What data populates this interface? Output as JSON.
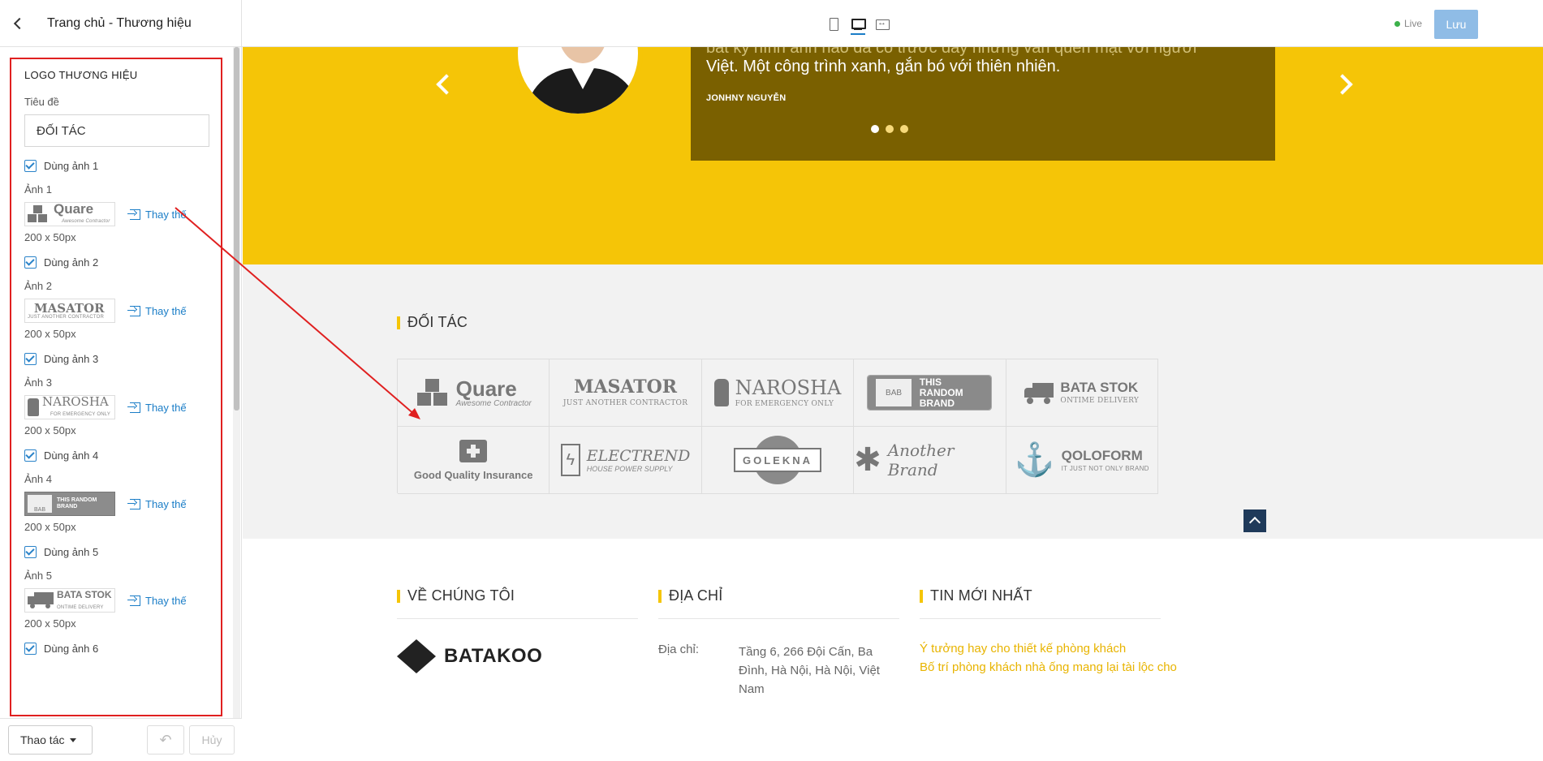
{
  "sidebar": {
    "title": "Trang chủ - Thương hiệu",
    "panel_title": "LOGO THƯƠNG HIỆU",
    "title_label": "Tiêu đề",
    "title_value": "ĐỐI TÁC",
    "items": [
      {
        "use_label": "Dùng ảnh 1",
        "img_label": "Ảnh 1",
        "thumb_main": "Quare",
        "thumb_sub": "Awesome Contractor",
        "replace": "Thay thế",
        "size": "200 x 50px"
      },
      {
        "use_label": "Dùng ảnh 2",
        "img_label": "Ảnh 2",
        "thumb_main": "MASATOR",
        "thumb_sub": "JUST ANOTHER CONTRACTOR",
        "replace": "Thay thế",
        "size": "200 x 50px"
      },
      {
        "use_label": "Dùng ảnh 3",
        "img_label": "Ảnh 3",
        "thumb_main": "NAROSHA",
        "thumb_sub": "FOR EMERGENCY ONLY",
        "replace": "Thay thế",
        "size": "200 x 50px"
      },
      {
        "use_label": "Dùng ảnh 4",
        "img_label": "Ảnh 4",
        "thumb_main": "THIS RANDOM BRAND",
        "thumb_sub": "BAB",
        "replace": "Thay thế",
        "size": "200 x 50px"
      },
      {
        "use_label": "Dùng ảnh 5",
        "img_label": "Ảnh 5",
        "thumb_main": "BATA STOK",
        "thumb_sub": "ONTIME DELIVERY",
        "replace": "Thay thế",
        "size": "200 x 50px"
      }
    ],
    "next_use_label": "Dùng ảnh 6",
    "actions_label": "Thao tác",
    "undo_icon": "↶",
    "cancel_label": "Hủy"
  },
  "topbar": {
    "live_label": "Live",
    "save_label": "Lưu"
  },
  "testimonial": {
    "line1": "bất kỳ hình ảnh nào đã có trước đây nhưng vẫn quen mặt với người",
    "line2": "Việt. Một công trình xanh, gắn bó với thiên nhiên.",
    "author": "JONHNY NGUYỄN"
  },
  "partners": {
    "title": "ĐỐI TÁC",
    "logos": [
      {
        "main": "Quare",
        "sub": "Awesome Contractor"
      },
      {
        "main": "MASATOR",
        "sub": "JUST ANOTHER CONTRACTOR"
      },
      {
        "main": "NAROSHA",
        "sub": "FOR EMERGENCY ONLY"
      },
      {
        "main": "THIS RANDOM BRAND",
        "sub": "BAB"
      },
      {
        "main": "BATA STOK",
        "sub": "ONTIME DELIVERY"
      },
      {
        "main": "Good Quality Insurance",
        "sub": ""
      },
      {
        "main": "ELECTREND",
        "sub": "HOUSE POWER SUPPLY"
      },
      {
        "main": "GOLEKNA",
        "sub": ""
      },
      {
        "main": "Another Brand",
        "sub": ""
      },
      {
        "main": "QOLOFORM",
        "sub": "IT JUST NOT ONLY BRAND"
      }
    ]
  },
  "footer": {
    "about_title": "VỀ CHÚNG TÔI",
    "address_title": "ĐỊA CHỈ",
    "news_title": "TIN MỚI NHẤT",
    "brand": "BATAKOO",
    "address_label": "Địa chỉ:",
    "address_value": "Tầng 6, 266 Đội Cấn, Ba Đình, Hà Nội, Hà Nội, Việt Nam",
    "news": [
      "Ý tưởng hay cho thiết kế phòng khách",
      "Bố trí phòng khách nhà ống mang lại tài lộc cho"
    ]
  },
  "colors": {
    "accent_yellow": "#f5c507",
    "annotation_red": "#e02020",
    "link_blue": "#1a7dc7"
  }
}
